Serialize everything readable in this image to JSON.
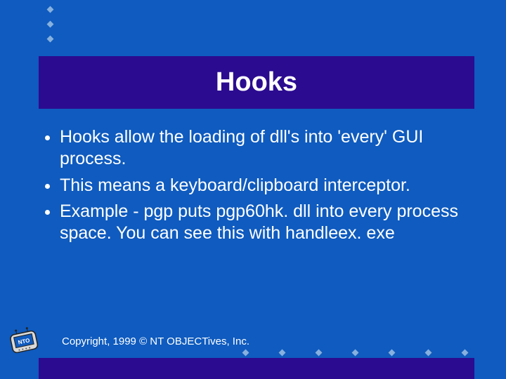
{
  "title": "Hooks",
  "bullets": [
    "Hooks allow the loading of dll's into 'every' GUI process.",
    "This means a keyboard/clipboard interceptor.",
    "Example - pgp puts pgp60hk. dll into every process space. You can see this with handleex. exe"
  ],
  "copyright": "Copyright, 1999 © NT OBJECTives, Inc.",
  "colors": {
    "background": "#0f5bbf",
    "accent": "#2b0b90",
    "text": "#ffffff",
    "diamond": "#87b0de"
  },
  "logo_label": "NTO"
}
